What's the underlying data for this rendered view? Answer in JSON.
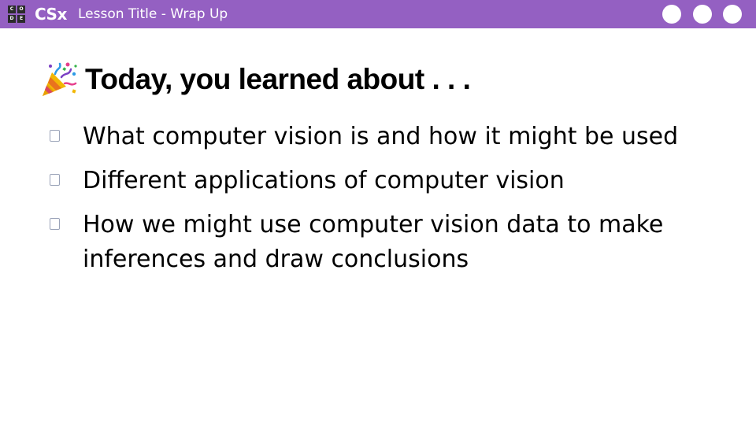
{
  "header": {
    "logo_letters": [
      "C",
      "O",
      "D",
      "E"
    ],
    "brand": "CSx",
    "lesson_title": "Lesson Title - Wrap Up",
    "background_color": "#9460c2"
  },
  "slide": {
    "heading_icon": "party-popper-icon",
    "heading": "Today, you learned about . . .",
    "bullets": [
      {
        "text": "What computer vision is and how it might be used"
      },
      {
        "text": "Different applications of computer vision"
      },
      {
        "text": "How we might use computer vision data to make inferences and draw conclusions"
      }
    ]
  }
}
